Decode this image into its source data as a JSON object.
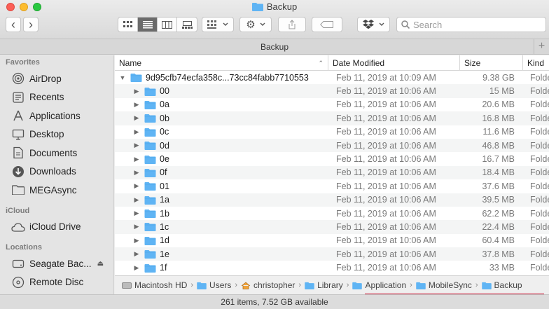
{
  "window": {
    "title": "Backup"
  },
  "toolbar": {
    "back": "‹",
    "forward": "›",
    "search_placeholder": "Search"
  },
  "tabbar": {
    "label": "Backup",
    "add": "+"
  },
  "sidebar": {
    "sections": [
      {
        "heading": "Favorites",
        "items": [
          {
            "label": "AirDrop",
            "icon": "airdrop-icon"
          },
          {
            "label": "Recents",
            "icon": "recents-icon"
          },
          {
            "label": "Applications",
            "icon": "applications-icon"
          },
          {
            "label": "Desktop",
            "icon": "desktop-icon"
          },
          {
            "label": "Documents",
            "icon": "documents-icon"
          },
          {
            "label": "Downloads",
            "icon": "downloads-icon"
          },
          {
            "label": "MEGAsync",
            "icon": "folder-icon"
          }
        ]
      },
      {
        "heading": "iCloud",
        "items": [
          {
            "label": "iCloud Drive",
            "icon": "cloud-icon"
          }
        ]
      },
      {
        "heading": "Locations",
        "items": [
          {
            "label": "Seagate Bac...",
            "icon": "drive-icon",
            "eject": "⏏"
          },
          {
            "label": "Remote Disc",
            "icon": "disc-icon"
          }
        ]
      }
    ]
  },
  "columns": {
    "name": "Name",
    "date": "Date Modified",
    "size": "Size",
    "kind": "Kind"
  },
  "rows": [
    {
      "name": "9d95cfb74ecfa358c...73cc84fabb7710553",
      "date": "Feb 11, 2019 at 10:09 AM",
      "size": "9.38 GB",
      "kind": "Folder",
      "expanded": true,
      "level": 0
    },
    {
      "name": "00",
      "date": "Feb 11, 2019 at 10:06 AM",
      "size": "15 MB",
      "kind": "Folder",
      "level": 1
    },
    {
      "name": "0a",
      "date": "Feb 11, 2019 at 10:06 AM",
      "size": "20.6 MB",
      "kind": "Folder",
      "level": 1
    },
    {
      "name": "0b",
      "date": "Feb 11, 2019 at 10:06 AM",
      "size": "16.8 MB",
      "kind": "Folder",
      "level": 1
    },
    {
      "name": "0c",
      "date": "Feb 11, 2019 at 10:06 AM",
      "size": "11.6 MB",
      "kind": "Folder",
      "level": 1
    },
    {
      "name": "0d",
      "date": "Feb 11, 2019 at 10:06 AM",
      "size": "46.8 MB",
      "kind": "Folder",
      "level": 1
    },
    {
      "name": "0e",
      "date": "Feb 11, 2019 at 10:06 AM",
      "size": "16.7 MB",
      "kind": "Folder",
      "level": 1
    },
    {
      "name": "0f",
      "date": "Feb 11, 2019 at 10:06 AM",
      "size": "18.4 MB",
      "kind": "Folder",
      "level": 1
    },
    {
      "name": "01",
      "date": "Feb 11, 2019 at 10:06 AM",
      "size": "37.6 MB",
      "kind": "Folder",
      "level": 1
    },
    {
      "name": "1a",
      "date": "Feb 11, 2019 at 10:06 AM",
      "size": "39.5 MB",
      "kind": "Folder",
      "level": 1
    },
    {
      "name": "1b",
      "date": "Feb 11, 2019 at 10:06 AM",
      "size": "62.2 MB",
      "kind": "Folder",
      "level": 1
    },
    {
      "name": "1c",
      "date": "Feb 11, 2019 at 10:06 AM",
      "size": "22.4 MB",
      "kind": "Folder",
      "level": 1
    },
    {
      "name": "1d",
      "date": "Feb 11, 2019 at 10:06 AM",
      "size": "60.4 MB",
      "kind": "Folder",
      "level": 1
    },
    {
      "name": "1e",
      "date": "Feb 11, 2019 at 10:06 AM",
      "size": "37.8 MB",
      "kind": "Folder",
      "level": 1
    },
    {
      "name": "1f",
      "date": "Feb 11, 2019 at 10:06 AM",
      "size": "33 MB",
      "kind": "Folder",
      "level": 1
    }
  ],
  "pathbar": [
    {
      "label": "Macintosh HD",
      "icon": "drive-icon"
    },
    {
      "label": "Users",
      "icon": "folder-icon"
    },
    {
      "label": "christopher",
      "icon": "home-icon"
    },
    {
      "label": "Library",
      "icon": "folder-icon"
    },
    {
      "label": "Application",
      "icon": "folder-icon"
    },
    {
      "label": "MobileSync",
      "icon": "folder-icon"
    },
    {
      "label": "Backup",
      "icon": "folder-icon"
    }
  ],
  "status": {
    "text": "261 items, 7.52 GB available"
  },
  "colors": {
    "folder": "#5fb4f4",
    "highlight_underline": "#c8102e"
  }
}
